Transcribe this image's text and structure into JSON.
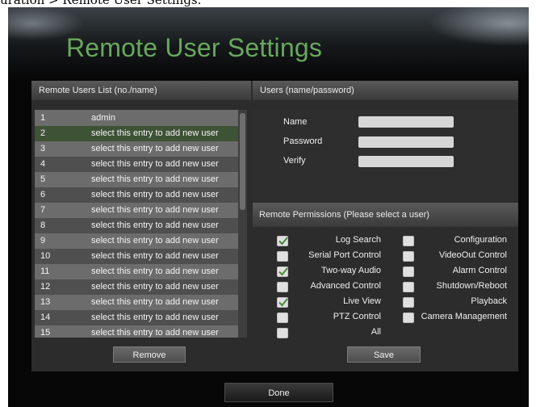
{
  "caption": "uration > Remote User Settings.",
  "title": "Remote User Settings",
  "list_header": "Remote Users List (no./name)",
  "users_header": "Users (name/password)",
  "users": [
    {
      "no": "1",
      "name": "admin"
    },
    {
      "no": "2",
      "name": "select this entry to add new user"
    },
    {
      "no": "3",
      "name": "select this entry to add new user"
    },
    {
      "no": "4",
      "name": "select this entry to add new user"
    },
    {
      "no": "5",
      "name": "select this entry to add new user"
    },
    {
      "no": "6",
      "name": "select this entry to add new user"
    },
    {
      "no": "7",
      "name": "select this entry to add new user"
    },
    {
      "no": "8",
      "name": "select this entry to add new user"
    },
    {
      "no": "9",
      "name": "select this entry to add new user"
    },
    {
      "no": "10",
      "name": "select this entry to add new user"
    },
    {
      "no": "11",
      "name": "select this entry to add new user"
    },
    {
      "no": "12",
      "name": "select this entry to add new user"
    },
    {
      "no": "13",
      "name": "select this entry to add new user"
    },
    {
      "no": "14",
      "name": "select this entry to add new user"
    },
    {
      "no": "15",
      "name": "select this entry to add new user"
    }
  ],
  "form": {
    "name_label": "Name",
    "password_label": "Password",
    "verify_label": "Verify",
    "name_value": "",
    "password_value": "",
    "verify_value": ""
  },
  "permissions_header": "Remote Permissions (Please select a user)",
  "permissions_left": [
    {
      "label": "Log Search",
      "checked": true
    },
    {
      "label": "Serial Port Control",
      "checked": false
    },
    {
      "label": "Two-way Audio",
      "checked": true
    },
    {
      "label": "Advanced Control",
      "checked": false
    },
    {
      "label": "Live View",
      "checked": true
    },
    {
      "label": "PTZ Control",
      "checked": false
    },
    {
      "label": "All",
      "checked": false
    }
  ],
  "permissions_right": [
    {
      "label": "Configuration",
      "checked": false
    },
    {
      "label": "VideoOut Control",
      "checked": false
    },
    {
      "label": "Alarm Control",
      "checked": false
    },
    {
      "label": "Shutdown/Reboot",
      "checked": false
    },
    {
      "label": "Playback",
      "checked": false
    },
    {
      "label": "Camera Management",
      "checked": false
    }
  ],
  "buttons": {
    "remove": "Remove",
    "save": "Save",
    "done": "Done"
  },
  "colors": {
    "title": "#68a85e",
    "selected_row": "#3e5236",
    "row_light": "#6c6c6c",
    "row_dark": "#4f4f4f",
    "checkmark": "#4a8a3a"
  }
}
